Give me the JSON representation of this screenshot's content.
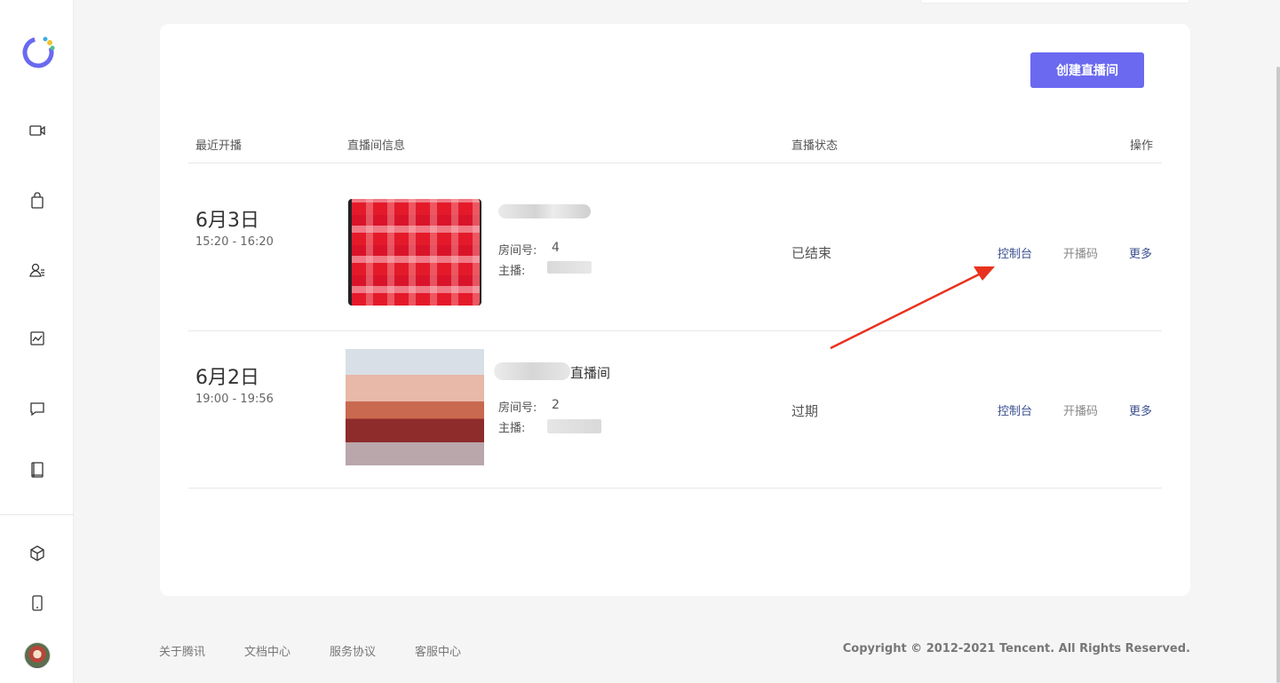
{
  "header": {
    "create_button_label": "创建直播间"
  },
  "table": {
    "columns": [
      "最近开播",
      "直播间信息",
      "直播状态",
      "操作"
    ],
    "rows": [
      {
        "date": "6月3日",
        "time": "15:20 - 16:20",
        "room_title_suffix": "",
        "room_label": "房间号:",
        "room_number": "4",
        "host_label": "主播:",
        "status": "已结束",
        "actions": [
          "控制台",
          "开播码",
          "更多"
        ]
      },
      {
        "date": "6月2日",
        "time": "19:00 - 19:56",
        "room_title_suffix": "直播间",
        "room_label": "房间号:",
        "room_number": "2",
        "host_label": "主播:",
        "status": "过期",
        "actions": [
          "控制台",
          "开播码",
          "更多"
        ]
      }
    ]
  },
  "footer": {
    "links": [
      "关于腾讯",
      "文档中心",
      "服务协议",
      "客服中心"
    ],
    "copyright": "Copyright © 2012-2021 Tencent. All Rights Reserved."
  },
  "sidebar": {
    "icons": [
      "video-icon",
      "shopping-bag-icon",
      "user-list-icon",
      "chart-icon",
      "message-icon",
      "book-icon",
      "package-icon",
      "mobile-icon"
    ]
  },
  "colors": {
    "accent": "#6a69f0",
    "link": "#3a4f8f",
    "annotation_arrow": "#e8321e"
  }
}
